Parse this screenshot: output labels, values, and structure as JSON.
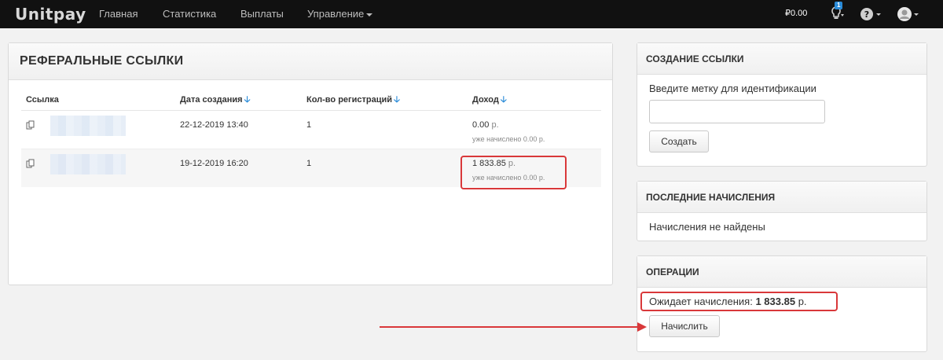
{
  "nav": {
    "logo": "Unitpay",
    "items": [
      {
        "label": "Главная"
      },
      {
        "label": "Статистика"
      },
      {
        "label": "Выплаты"
      },
      {
        "label": "Управление"
      }
    ],
    "balance": "₽0.00",
    "notification_count": "1",
    "icons": [
      "lightbulb-icon",
      "help-icon",
      "avatar-icon"
    ]
  },
  "referrals": {
    "title": "Реферальные ссылки",
    "columns": [
      "Ссылка",
      "Дата создания",
      "Кол-во регистраций",
      "Доход"
    ],
    "rows": [
      {
        "date": "22-12-2019 13:40",
        "registrations": "1",
        "income": "0.00",
        "currency": "р.",
        "accrued": "уже начислено 0.00 р."
      },
      {
        "date": "19-12-2019 16:20",
        "registrations": "1",
        "income": "1 833.85",
        "currency": "р.",
        "accrued": "уже начислено 0.00 р."
      }
    ]
  },
  "create_link": {
    "title": "Создание ссылки",
    "label": "Введите метку для идентификации",
    "input_value": "",
    "button": "Создать"
  },
  "recent": {
    "title": "Последние начисления",
    "empty_text": "Начисления не найдены"
  },
  "operations": {
    "title": "Операции",
    "pending_label": "Ожидает начисления:",
    "pending_amount": "1 833.85",
    "pending_currency": "р.",
    "button": "Начислить"
  },
  "colors": {
    "navbar": "#111111",
    "accent": "#2a8bd8",
    "highlight": "#d9383a"
  }
}
